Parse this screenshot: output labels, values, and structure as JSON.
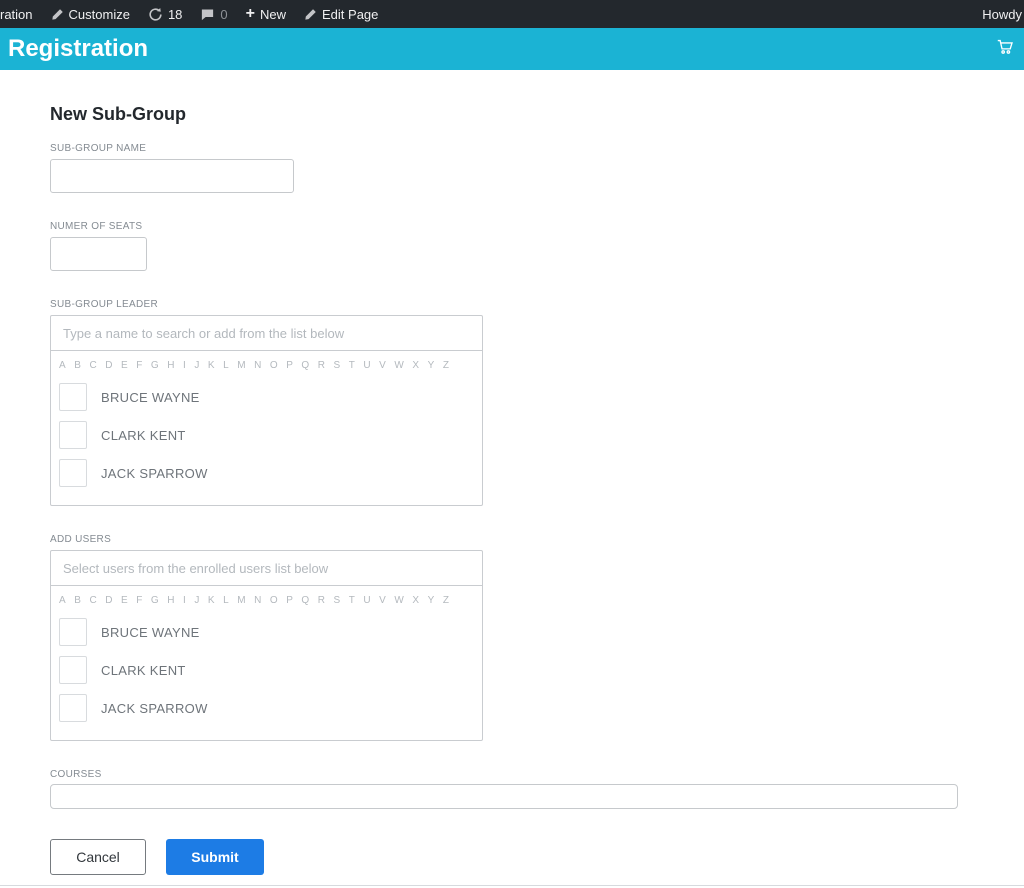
{
  "admin_bar": {
    "site_label": "ration",
    "customize_label": "Customize",
    "updates_count": "18",
    "comments_count": "0",
    "new_label": "New",
    "edit_page_label": "Edit Page",
    "howdy_label": "Howdy"
  },
  "header": {
    "title": "Registration"
  },
  "form": {
    "title": "New Sub-Group",
    "alphabet": [
      "A",
      "B",
      "C",
      "D",
      "E",
      "F",
      "G",
      "H",
      "I",
      "J",
      "K",
      "L",
      "M",
      "N",
      "O",
      "P",
      "Q",
      "R",
      "S",
      "T",
      "U",
      "V",
      "W",
      "X",
      "Y",
      "Z"
    ],
    "sub_group_name": {
      "label": "SUB-GROUP NAME",
      "value": ""
    },
    "number_of_seats": {
      "label": "NUMER OF SEATS",
      "value": ""
    },
    "sub_group_leader": {
      "label": "SUB-GROUP LEADER",
      "placeholder": "Type a name to search or add from the list below",
      "options": [
        "BRUCE WAYNE",
        "CLARK KENT",
        "JACK SPARROW"
      ]
    },
    "add_users": {
      "label": "ADD USERS",
      "placeholder": "Select users from the enrolled users list below",
      "options": [
        "BRUCE WAYNE",
        "CLARK KENT",
        "JACK SPARROW"
      ]
    },
    "courses": {
      "label": "COURSES",
      "value": ""
    },
    "buttons": {
      "cancel": "Cancel",
      "submit": "Submit"
    }
  },
  "colors": {
    "admin_bar_bg": "#23282d",
    "header_bg": "#1bb3d4",
    "submit_bg": "#1d7ce5"
  }
}
